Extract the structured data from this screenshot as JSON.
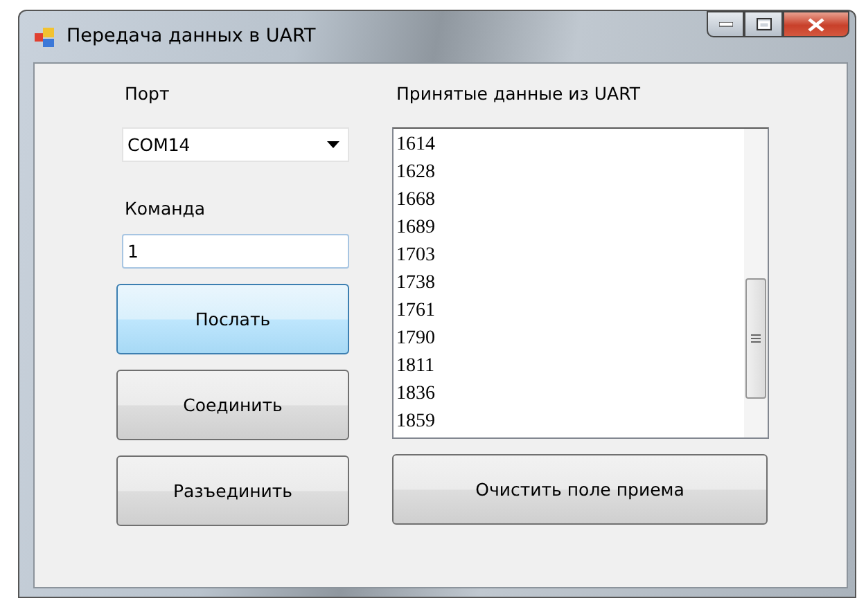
{
  "window": {
    "title": "Передача данных в UART"
  },
  "port": {
    "label": "Порт",
    "value": "COM14"
  },
  "command": {
    "label": "Команда",
    "value": "1"
  },
  "buttons": [
    {
      "label": "Послать",
      "highlighted": true
    },
    {
      "label": "Соединить",
      "highlighted": false
    },
    {
      "label": "Разъединить",
      "highlighted": false
    }
  ],
  "received": {
    "label": "Принятые данные из UART",
    "items": [
      "1614",
      "1628",
      "1668",
      "1689",
      "1703",
      "1738",
      "1761",
      "1790",
      "1811",
      "1836",
      "1859"
    ]
  },
  "clear_button": {
    "label": "Очистить поле приема",
    "highlighted": false
  }
}
